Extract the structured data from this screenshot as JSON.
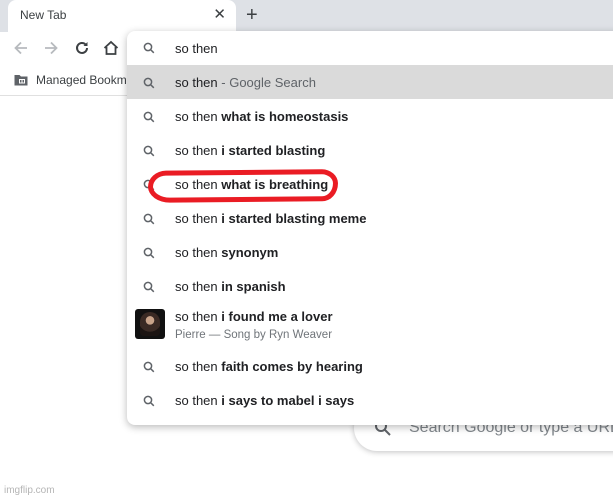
{
  "tab": {
    "title": "New Tab",
    "close_icon": "close-icon",
    "new_tab_icon": "plus-icon"
  },
  "toolbar": {
    "icons": [
      "back-arrow-icon",
      "forward-arrow-icon",
      "reload-icon",
      "home-icon"
    ]
  },
  "bookmarks": {
    "items": [
      {
        "label": "Managed Bookma",
        "icon": "managed-folder-icon"
      }
    ]
  },
  "omnibox": {
    "input_value": "so then",
    "suggestions": [
      {
        "prefix": "so then",
        "bold": "",
        "suffix": " - Google Search",
        "icon": "search-icon",
        "selected": true
      },
      {
        "prefix": "so then ",
        "bold": "what is homeostasis",
        "icon": "search-icon"
      },
      {
        "prefix": "so then ",
        "bold": "i started blasting",
        "icon": "search-icon"
      },
      {
        "prefix": "so then ",
        "bold": "what is breathing",
        "icon": "search-icon",
        "annotated": true
      },
      {
        "prefix": "so then ",
        "bold": "i started blasting meme",
        "icon": "search-icon"
      },
      {
        "prefix": "so then ",
        "bold": "synonym",
        "icon": "search-icon"
      },
      {
        "prefix": "so then ",
        "bold": "in spanish",
        "icon": "search-icon"
      },
      {
        "prefix": "so then ",
        "bold": "i found me a lover",
        "subtitle": "Pierre — Song by Ryn Weaver",
        "icon": "album-art-thumbnail"
      },
      {
        "prefix": "so then ",
        "bold": "faith comes by hearing",
        "icon": "search-icon"
      },
      {
        "prefix": "so then ",
        "bold": "i says to mabel i says",
        "icon": "search-icon"
      }
    ]
  },
  "ntp": {
    "search_placeholder": "Search Google or type a URL"
  },
  "annotation": {
    "color": "#ea1c24"
  },
  "watermark": "imgflip.com"
}
